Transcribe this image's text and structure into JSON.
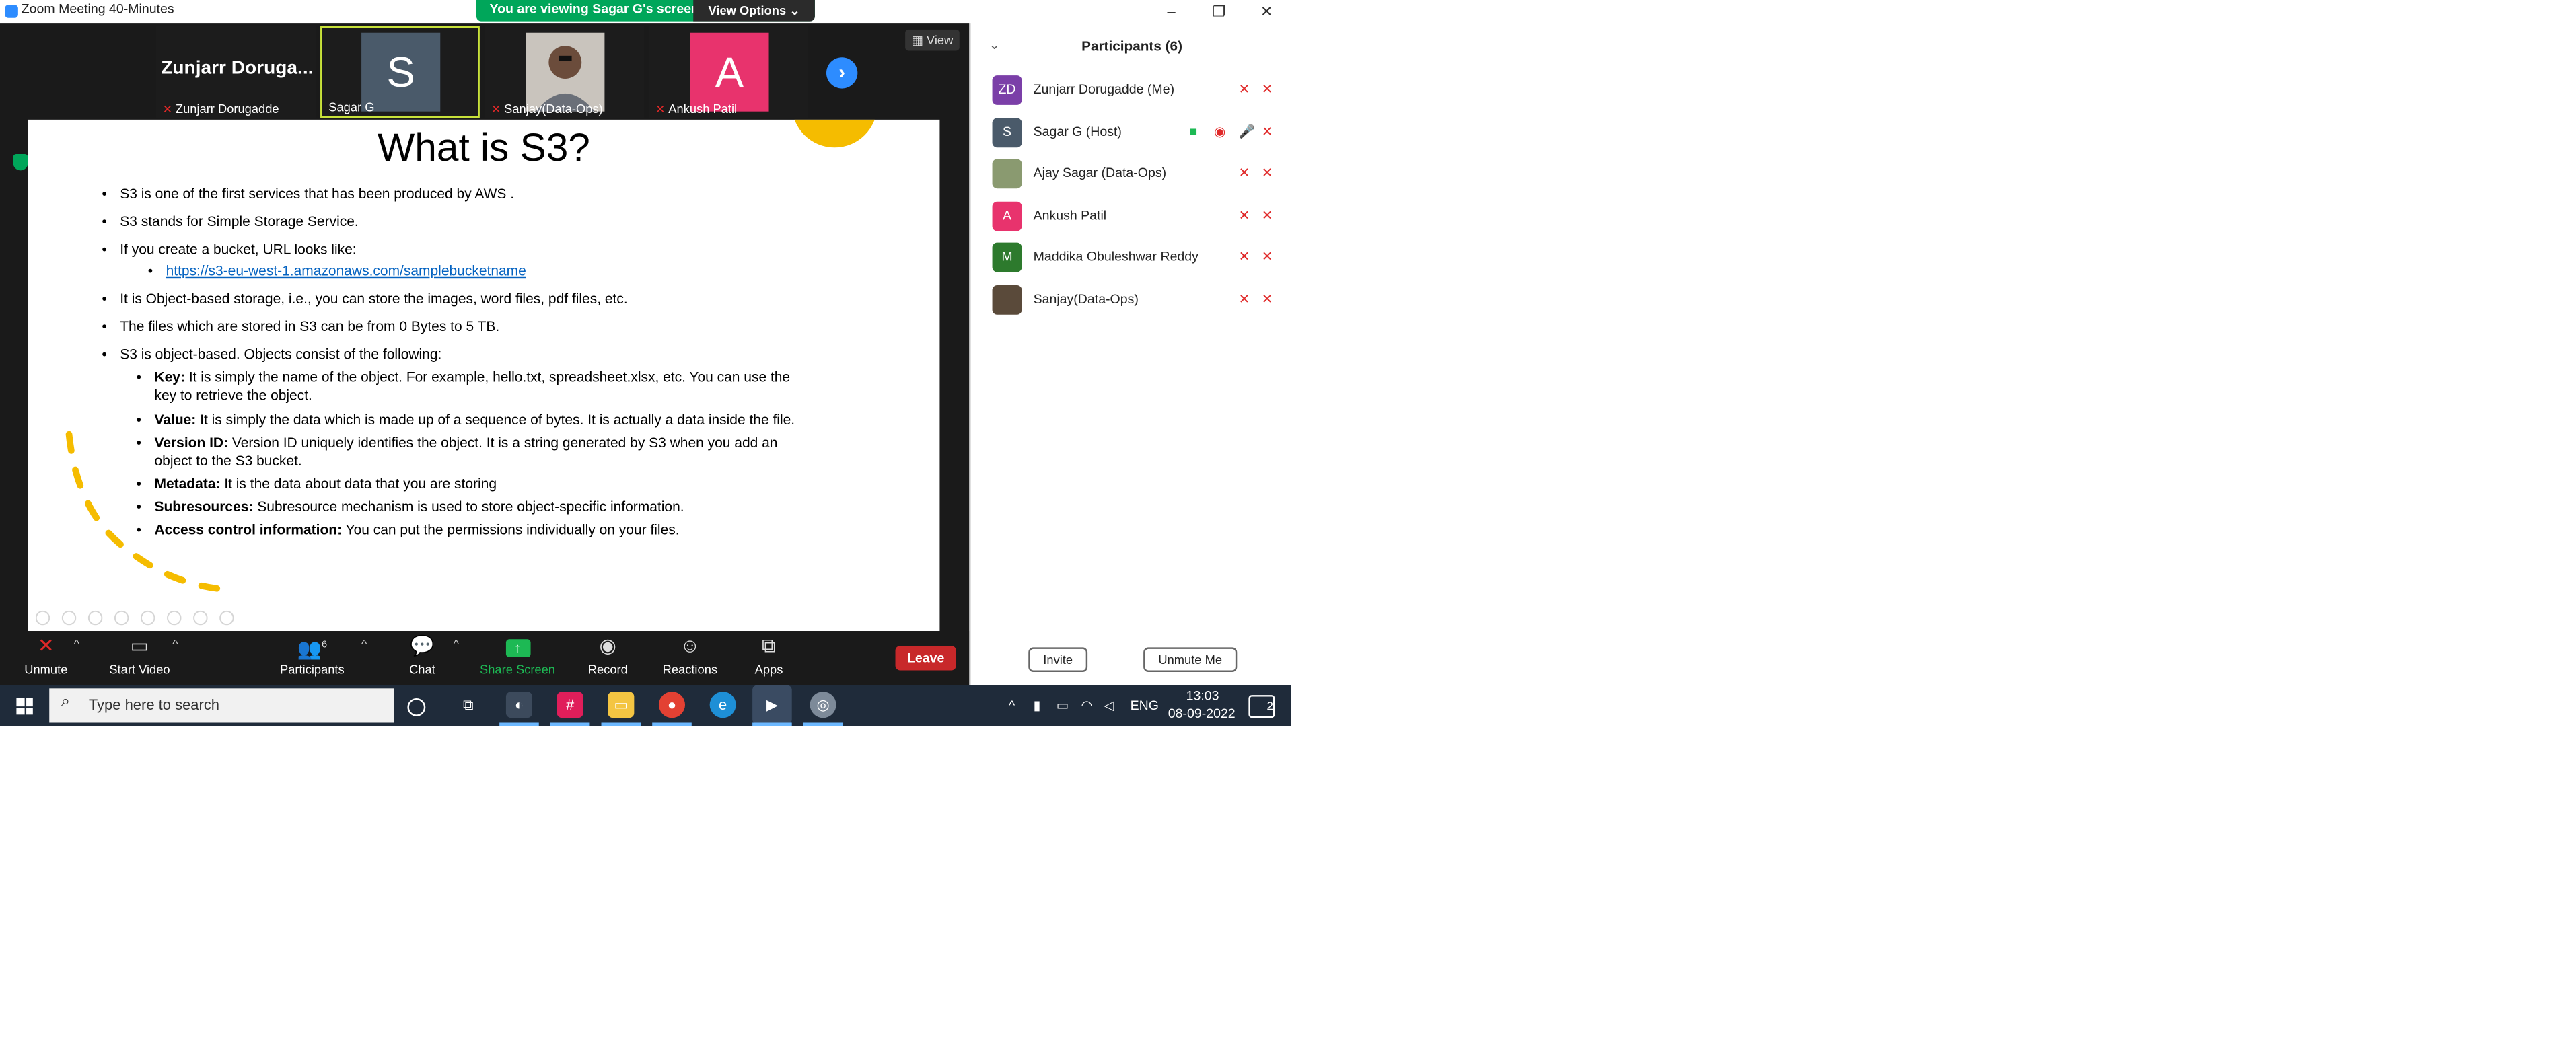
{
  "window": {
    "title": "Zoom Meeting 40-Minutes",
    "controls": [
      "–",
      "❐",
      "✕"
    ]
  },
  "banner": {
    "viewing_text": "You are viewing Sagar G's screen",
    "view_options": "View Options ⌄"
  },
  "gallery": {
    "tiles": [
      {
        "name": "Zunjarr Dorugadde",
        "display": "Zunjarr  Doruga..."
      },
      {
        "name": "Sagar G",
        "initial": "S"
      },
      {
        "name": "Sanjay(Data-Ops)"
      },
      {
        "name": "Ankush Patil",
        "initial": "A"
      }
    ],
    "view_label": "View"
  },
  "slide": {
    "title": "What is S3?",
    "bullets": [
      "S3 is one of the first services that has been produced by AWS        .",
      "S3 stands for Simple Storage Service.",
      "If you create a bucket, URL looks like:",
      "It is Object-based storage, i.e., you can store the images, word files, pdf files, etc.",
      "The files which are stored in S3 can be from 0 Bytes to 5 TB.",
      "S3 is object-based. Objects consist of the following:"
    ],
    "url": "https://s3-eu-west-1.amazonaws.com/samplebucketname",
    "sub": [
      {
        "key": "Key:",
        "text": " It is simply the name of the object. For example, hello.txt, spreadsheet.xlsx, etc. You can use the",
        "cont": "key to retrieve the object."
      },
      {
        "key": "Value:",
        "text": " It is simply the data which is made up of a sequence of bytes. It is actually a data inside the file."
      },
      {
        "key": "Version ID:",
        "text": " Version ID uniquely identifies the object. It is a string generated by S3 when you add an",
        "cont": "object to the S3 bucket."
      },
      {
        "key": "Metadata:",
        "text": " It is the data about data that you are storing"
      },
      {
        "key": "Subresources:",
        "text": " Subresource mechanism is used to store object-specific information."
      },
      {
        "key": "Access control information:",
        "text": " You can put the permissions individually on your files."
      }
    ]
  },
  "toolbar": {
    "unmute": "Unmute",
    "start_video": "Start Video",
    "participants": "Participants",
    "participants_count": "6",
    "chat": "Chat",
    "share_screen": "Share Screen",
    "record": "Record",
    "reactions": "Reactions",
    "apps": "Apps",
    "leave": "Leave"
  },
  "panel": {
    "title": "Participants (6)",
    "participants": [
      {
        "name": "Zunjarr Dorugadde (Me)",
        "initials": "ZD",
        "color": "#7b3fa8"
      },
      {
        "name": "Sagar G (Host)",
        "initials": "S",
        "color": "#4a5a6a"
      },
      {
        "name": "Ajay Sagar (Data-Ops)",
        "initials": "",
        "color": "#8a9a70"
      },
      {
        "name": "Ankush Patil",
        "initials": "A",
        "color": "#e8336d"
      },
      {
        "name": "Maddika Obuleshwar Reddy",
        "initials": "M",
        "color": "#2d7a2d"
      },
      {
        "name": "Sanjay(Data-Ops)",
        "initials": "",
        "color": "#5a4a3a"
      }
    ],
    "invite": "Invite",
    "unmute_me": "Unmute Me"
  },
  "taskbar": {
    "search_placeholder": "Type here to search",
    "language": "ENG",
    "time": "13:03",
    "date": "08-09-2022",
    "notifications": "2"
  }
}
